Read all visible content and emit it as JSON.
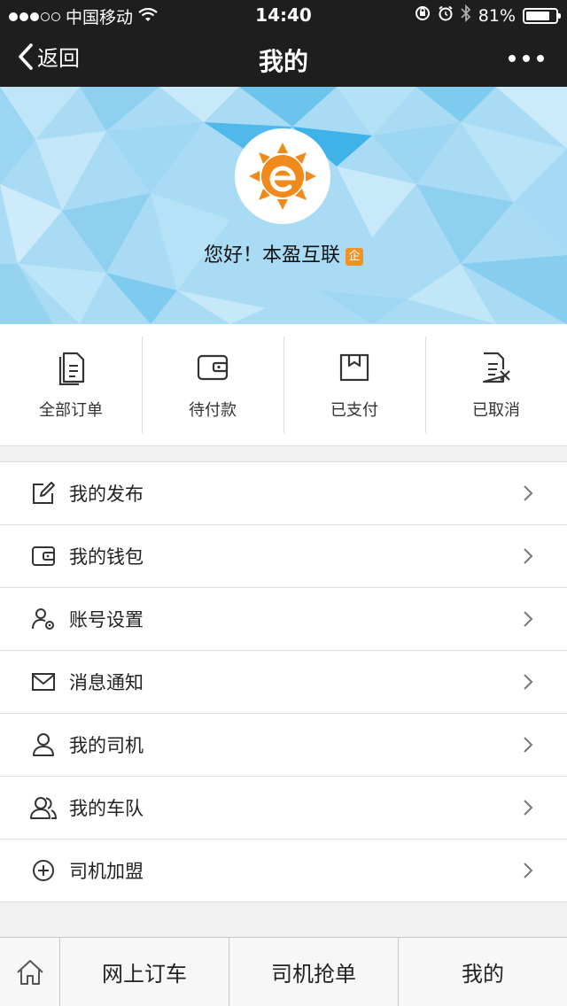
{
  "status_bar": {
    "carrier": "中国移动",
    "time": "14:40",
    "battery": "81%",
    "battery_level": 0.81,
    "signal_bars_filled": 3,
    "signal_bars_total": 5
  },
  "nav": {
    "back_label": "返回",
    "title": "我的"
  },
  "profile": {
    "greeting": "您好！本盈互联",
    "badge": "企"
  },
  "orders": [
    {
      "label": "全部订单",
      "icon": "document-icon"
    },
    {
      "label": "待付款",
      "icon": "wallet-icon"
    },
    {
      "label": "已支付",
      "icon": "box-icon"
    },
    {
      "label": "已取消",
      "icon": "cancel-document-icon"
    }
  ],
  "menu": [
    {
      "label": "我的发布",
      "icon": "edit-icon"
    },
    {
      "label": "我的钱包",
      "icon": "wallet-icon"
    },
    {
      "label": "账号设置",
      "icon": "user-settings-icon"
    },
    {
      "label": "消息通知",
      "icon": "mail-icon"
    },
    {
      "label": "我的司机",
      "icon": "person-icon"
    },
    {
      "label": "我的车队",
      "icon": "team-icon"
    },
    {
      "label": "司机加盟",
      "icon": "plus-circle-icon"
    }
  ],
  "tabbar": {
    "home_icon": "home-icon",
    "tabs": [
      "网上订车",
      "司机抢单",
      "我的"
    ]
  },
  "colors": {
    "topbar": "#1e1e1f",
    "banner": "#9fd8f3",
    "logo_orange": "#f08a1c",
    "badge_orange": "#f29222"
  }
}
